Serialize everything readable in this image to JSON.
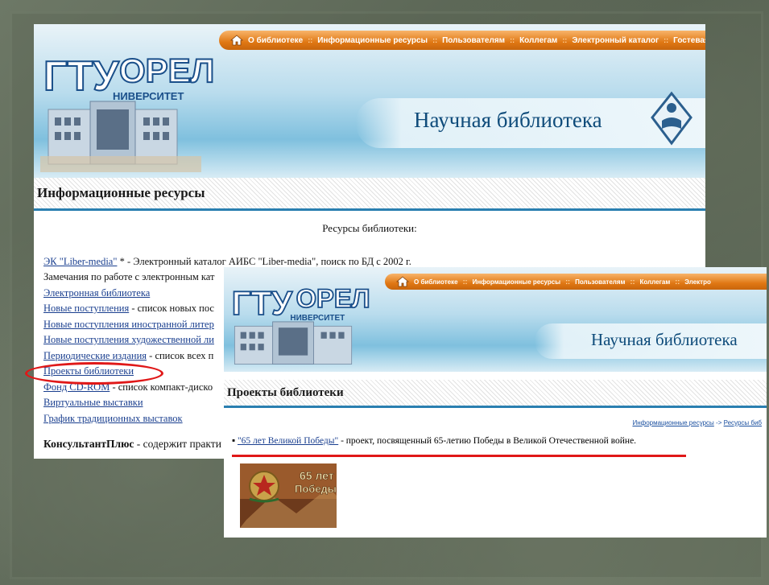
{
  "nav": {
    "items": [
      "О библиотеке",
      "Информационные ресурсы",
      "Пользователям",
      "Коллегам",
      "Электронный каталог",
      "Гостевая"
    ],
    "items2": [
      "О библиотеке",
      "Информационные ресурсы",
      "Пользователям",
      "Коллегам",
      "Электро"
    ]
  },
  "logo": {
    "letters": "ГТУ",
    "city": "ОРЕЛ",
    "sub": "НИВЕРСИТЕТ"
  },
  "header": {
    "title": "Научная библиотека"
  },
  "page1": {
    "section_title": "Информационные ресурсы",
    "resources_title": "Ресурсы библиотеки:",
    "items": [
      {
        "link": "ЭК \"Liber-media\"",
        "text": " * - Электронный каталог АИБС \"Liber-media\", поиск по БД с 2002 г."
      },
      {
        "link": "",
        "text": "Замечания по работе с электронным кат"
      },
      {
        "link": "Электронная библиотека",
        "text": ""
      },
      {
        "link": "Новые поступления",
        "text": " - список новых пос"
      },
      {
        "link": "Новые поступления иностранной литер",
        "text": ""
      },
      {
        "link": "Новые поступления художественной ли",
        "text": ""
      },
      {
        "link": "Периодические издания",
        "text": " - список всех п"
      },
      {
        "link": "Проекты библиотеки",
        "text": ""
      },
      {
        "link": "Фонд CD-ROM",
        "text": " - список компакт-диско"
      },
      {
        "link": "Виртуальные выставки",
        "text": ""
      },
      {
        "link": "График традиционных выставок",
        "text": ""
      }
    ],
    "bold_item": "КонсультантПлюс",
    "bold_tail": " - содержит практи"
  },
  "page2": {
    "section_title": "Проекты библиотеки",
    "crumb_1": "Информационные ресурсы",
    "crumb_arrow": " -> ",
    "crumb_2": "Ресурсы биб",
    "project_link": "\"65 лет Великой Победы\"",
    "project_text": " - проект, посвященный 65-летию Победы в Великой Отечественной войне.",
    "bullet": "▪",
    "image_caption_1": "65 лет",
    "image_caption_2": "Победы"
  },
  "colors": {
    "accent_orange": "#e07814",
    "accent_blue": "#2a7fb0",
    "highlight_red": "#e01818",
    "link_blue": "#1a3f8f"
  }
}
